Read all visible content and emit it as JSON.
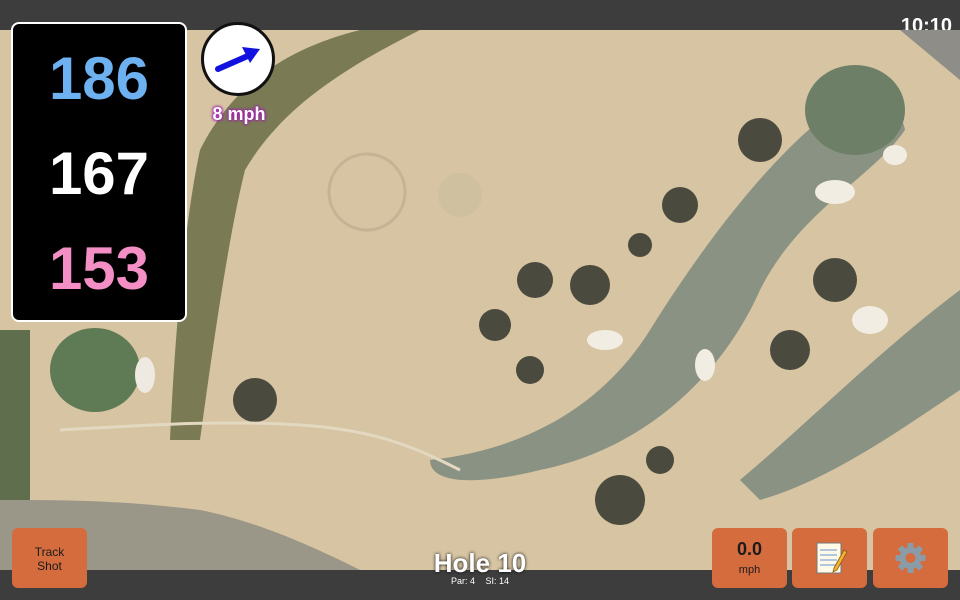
{
  "status_bar": {
    "time": "10:10"
  },
  "yardages": {
    "back": "186",
    "middle": "167",
    "front": "153"
  },
  "wind": {
    "speed": "8 mph",
    "arrow_icon": "arrow-right-icon"
  },
  "hole": {
    "title": "Hole 10",
    "par_label": "Par: 4",
    "si_label": "SI: 14"
  },
  "buttons": {
    "track_shot_line1": "Track",
    "track_shot_line2": "Shot",
    "speed_value": "0.0",
    "speed_unit": "mph",
    "notes_icon": "notepad-icon",
    "settings_icon": "gear-icon"
  },
  "colors": {
    "back_yardage": "#6db1f0",
    "middle_yardage": "#ffffff",
    "front_yardage": "#f38fc4",
    "button": "#d46c3e",
    "wind_label_glow": "#a11bb0"
  }
}
